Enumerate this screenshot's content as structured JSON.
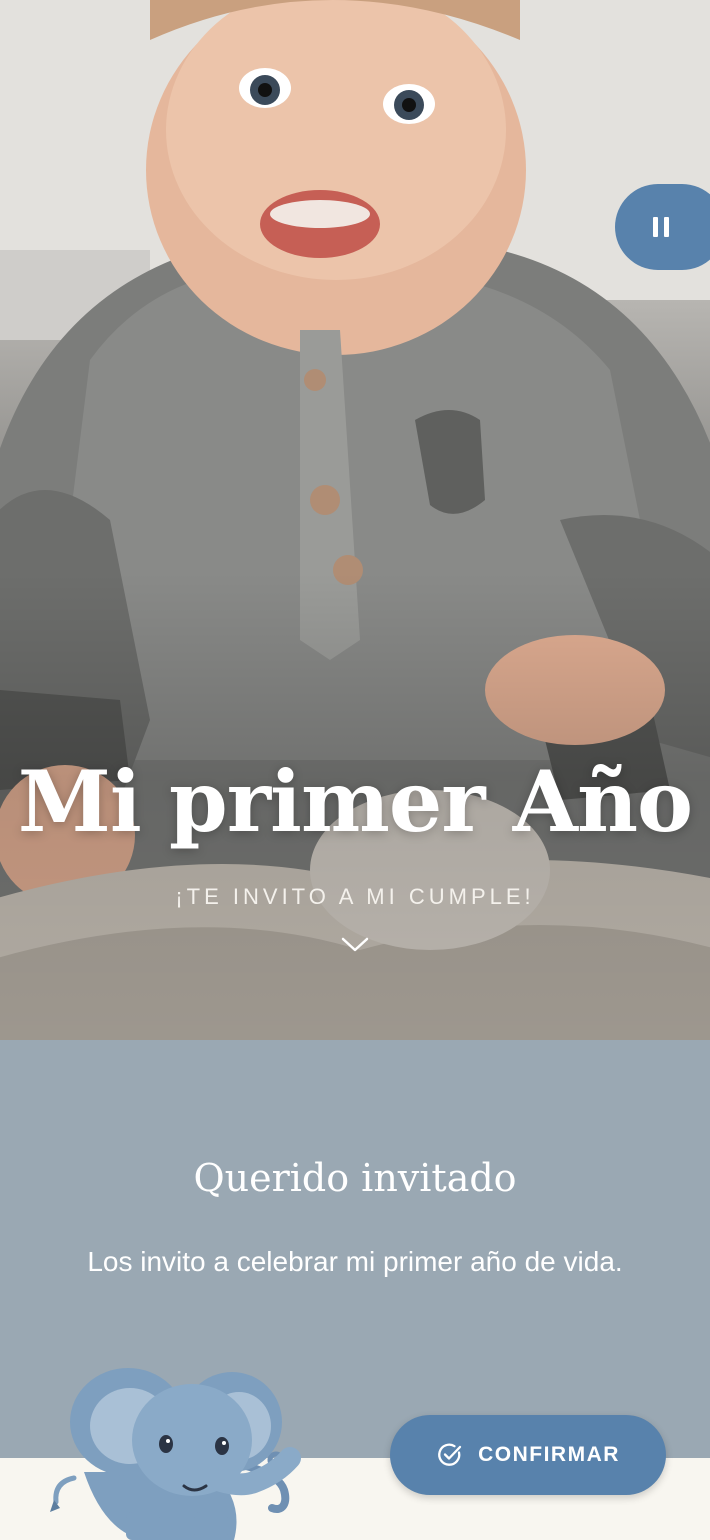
{
  "hero": {
    "title": "Mi primer Año",
    "subtitle": "¡TE INVITO A MI CUMPLE!",
    "photo_icon": "baby-photo",
    "scroll_icon": "chevron-down-icon"
  },
  "audio": {
    "icon": "pause-icon"
  },
  "message": {
    "title": "Querido invitado",
    "body": "Los invito a celebrar mi primer año de vida."
  },
  "decoration": {
    "icon": "elephant-illustration"
  },
  "confirm": {
    "label": "CONFIRMAR",
    "icon": "check-circle-icon"
  },
  "colors": {
    "accent": "#5882ac",
    "message_bg": "#9aa8b3",
    "footer_bg": "#f8f6f0"
  }
}
